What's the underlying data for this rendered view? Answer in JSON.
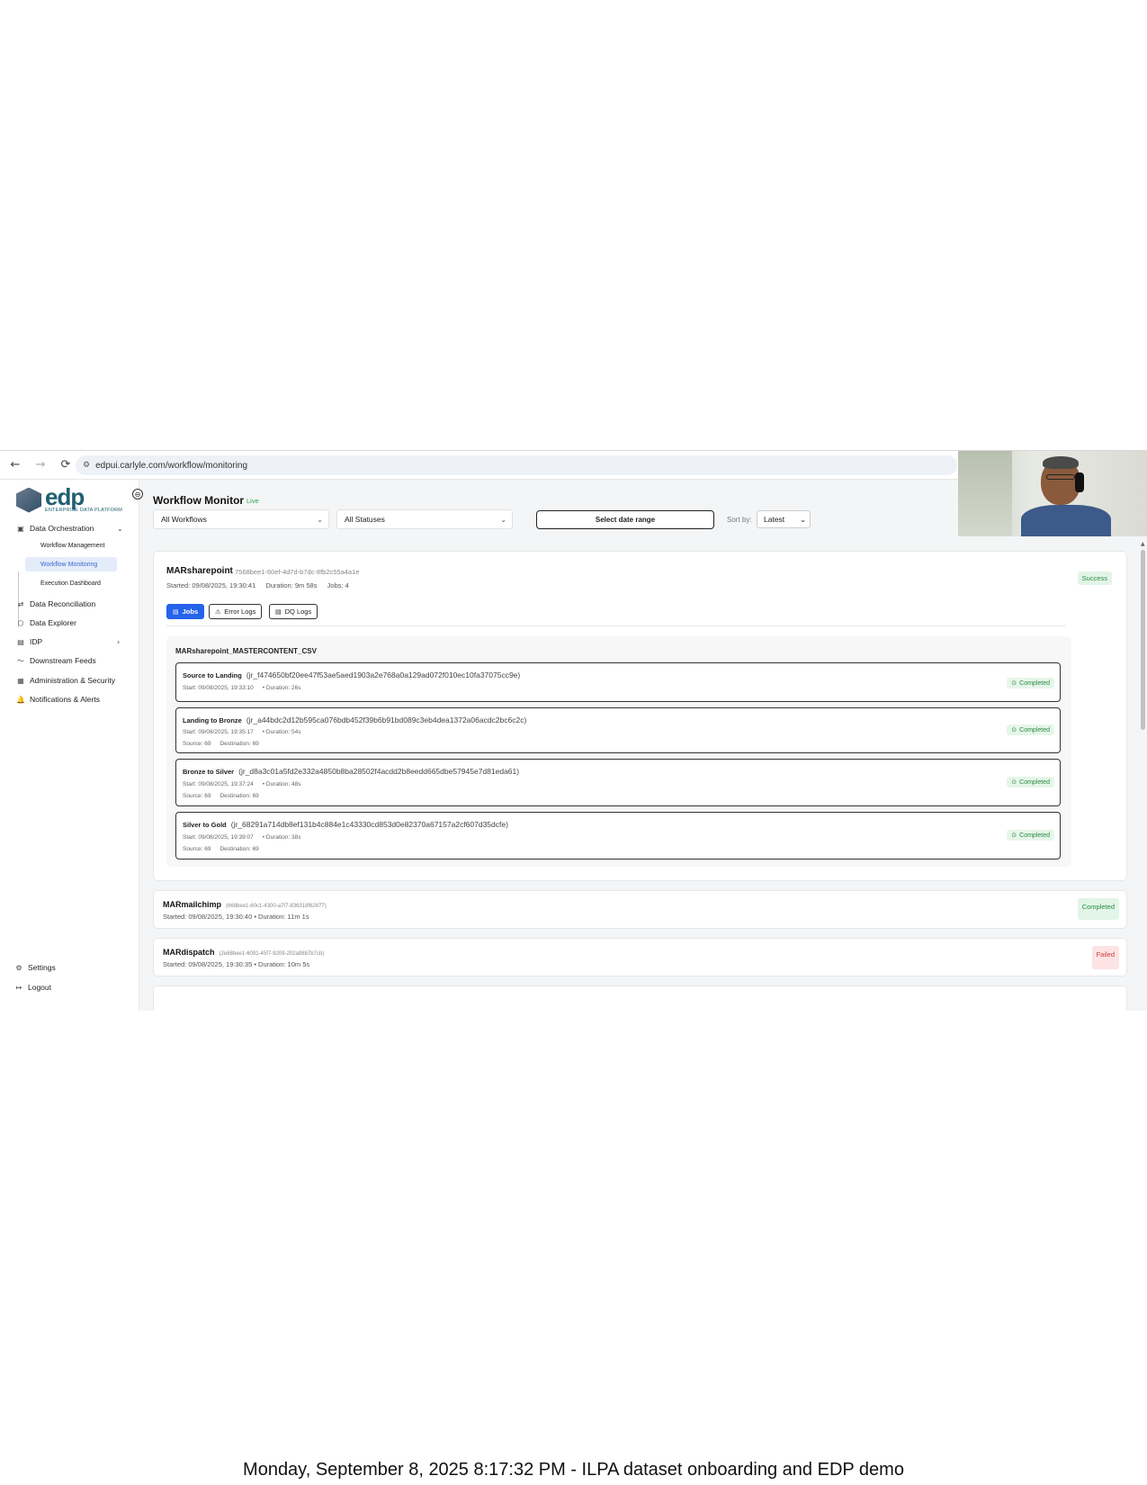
{
  "browser": {
    "url": "edpui.carlyle.com/workflow/monitoring",
    "back_icon": "←",
    "forward_icon": "→",
    "reload_icon": "⟳",
    "site_icon": "⚙"
  },
  "logo": {
    "word": "edp",
    "subtitle": "ENTERPRISE DATA PLATFORM"
  },
  "sidebar": {
    "collapse_icon": "⊖",
    "items": [
      {
        "label": "Data Orchestration",
        "icon": "▣",
        "chevron": "⌄"
      },
      {
        "label": "Data Reconciliation",
        "icon": "⇄"
      },
      {
        "label": "Data Explorer",
        "icon": "⬡"
      },
      {
        "label": "IDP",
        "icon": "▤",
        "chevron": "›"
      },
      {
        "label": "Downstream Feeds",
        "icon": "〜"
      },
      {
        "label": "Administration & Security",
        "icon": "▦"
      },
      {
        "label": "Notifications & Alerts",
        "icon": "🔔"
      }
    ],
    "sub_items": [
      "Workflow Management",
      "Workflow Monitoring",
      "Execution Dashboard"
    ],
    "settings": {
      "label": "Settings",
      "icon": "⚙"
    },
    "logout": {
      "label": "Logout",
      "icon": "↦"
    }
  },
  "header": {
    "title": "Workflow Monitor",
    "live": "Live"
  },
  "filters": {
    "workflows": "All Workflows",
    "statuses": "All Statuses",
    "date_range": "Select date range",
    "sort_label": "Sort by:",
    "sort_value": "Latest"
  },
  "workflow": {
    "name": "MARsharepoint",
    "id": "7568bee1-60ef-4d7d-b7dc-8fb2c55a4a1e",
    "started": "Started: 09/08/2025, 19:30:41",
    "duration": "Duration: 9m 58s",
    "jobs": "Jobs: 4",
    "status": "Success",
    "tabs": [
      {
        "label": "Jobs",
        "icon": "▤"
      },
      {
        "label": "Error Logs",
        "icon": "⚠"
      },
      {
        "label": "DQ Logs",
        "icon": "▤"
      }
    ],
    "job_group": "MARsharepoint_MASTERCONTENT_CSV",
    "jobs_list": [
      {
        "stage": "Source to Landing",
        "id": "(jr_f474650bf20ee47f53ae5aed1903a2e768a0a129ad072f010ec10fa37075cc9e)",
        "start": "Start: 09/08/2025, 19:33:10",
        "duration": "• Duration: 26s",
        "source": "",
        "destination": "",
        "status": "Completed"
      },
      {
        "stage": "Landing to Bronze",
        "id": "(jr_a44bdc2d12b595ca076bdb452f39b6b91bd089c3eb4dea1372a06acdc2bc6c2c)",
        "start": "Start: 09/08/2025, 19:35:17",
        "duration": "• Duration: 54s",
        "source": "Source: 69",
        "destination": "Destination: 69",
        "status": "Completed"
      },
      {
        "stage": "Bronze to Silver",
        "id": "(jr_d8a3c01a5fd2e332a4850b8ba28502f4acdd2b8eedd665dbe57945e7d81eda61)",
        "start": "Start: 09/08/2025, 19:37:24",
        "duration": "• Duration: 48s",
        "source": "Source: 69",
        "destination": "Destination: 69",
        "status": "Completed"
      },
      {
        "stage": "Silver to Gold",
        "id": "(jr_68291a714db8ef131b4c884e1c43330cd853d0e82370a67157a2cf607d35dcfe)",
        "start": "Start: 09/08/2025, 19:39:07",
        "duration": "• Duration: 38s",
        "source": "Source: 69",
        "destination": "Destination: 69",
        "status": "Completed"
      }
    ]
  },
  "runs": [
    {
      "name": "MARmailchimp",
      "id": "(668bee1-60c1-4300-a7f7-836318f62877)",
      "meta": "Started: 09/08/2025, 19:30:40 • Duration: 11m 1s",
      "status": "Completed"
    },
    {
      "name": "MARdispatch",
      "id": "(2e68bee1-6091-45f7-9209-202a98b7b7cb)",
      "meta": "Started: 09/08/2025, 19:30:35 • Duration: 10m 5s",
      "status": "Failed"
    }
  ],
  "colors": {
    "accent": "#2563eb",
    "success": "#2a8a44",
    "failed": "#d03b3b",
    "brand": "#1f5f6f"
  },
  "caption": "Monday, September 8, 2025 8:17:32 PM - ILPA dataset onboarding and EDP demo"
}
